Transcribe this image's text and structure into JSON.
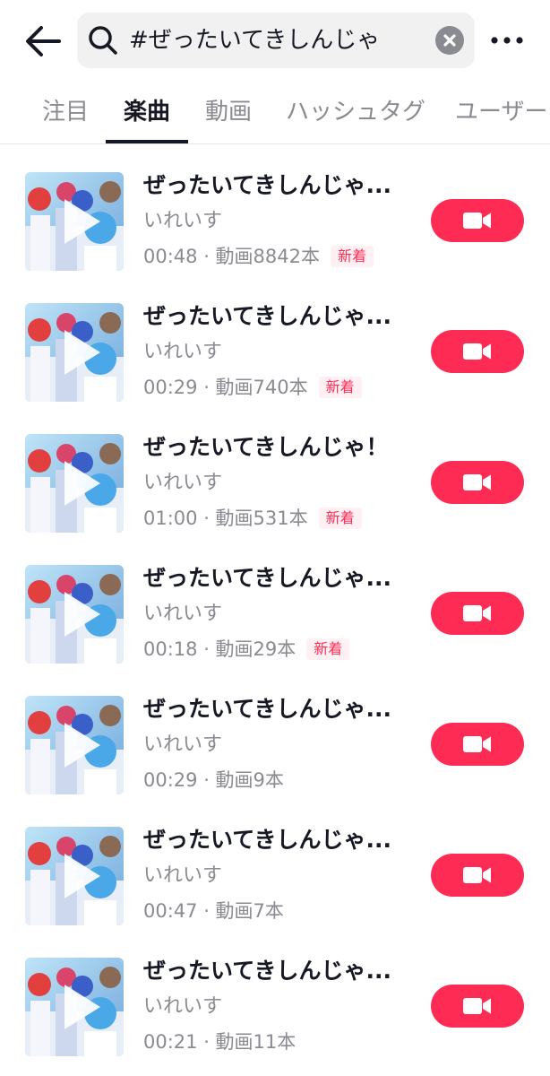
{
  "header": {
    "search_query": "#ぜったいてきしんじゃ"
  },
  "tabs": [
    {
      "label": "注目",
      "active": false
    },
    {
      "label": "楽曲",
      "active": true
    },
    {
      "label": "動画",
      "active": false
    },
    {
      "label": "ハッシュタグ",
      "active": false
    },
    {
      "label": "ユーザー",
      "active": false
    }
  ],
  "songs": [
    {
      "title": "ぜったいてきしんじゃ...",
      "artist": "いれいす",
      "meta": "00:48 · 動画8842本",
      "badge": "新着"
    },
    {
      "title": "ぜったいてきしんじゃ...",
      "artist": "いれいす",
      "meta": "00:29 · 動画740本",
      "badge": "新着"
    },
    {
      "title": "ぜったいてきしんじゃ！",
      "artist": "いれいす",
      "meta": "01:00 · 動画531本",
      "badge": "新着"
    },
    {
      "title": "ぜったいてきしんじゃ...",
      "artist": "いれいす",
      "meta": "00:18 · 動画29本",
      "badge": "新着"
    },
    {
      "title": "ぜったいてきしんじゃ...",
      "artist": "いれいす",
      "meta": "00:29 · 動画9本",
      "badge": ""
    },
    {
      "title": "ぜったいてきしんじゃ...",
      "artist": "いれいす",
      "meta": "00:47 · 動画7本",
      "badge": ""
    },
    {
      "title": "ぜったいてきしんじゃ...",
      "artist": "いれいす",
      "meta": "00:21 · 動画11本",
      "badge": ""
    }
  ],
  "colors": {
    "accent": "#fe2c55",
    "text_primary": "#161823",
    "text_secondary": "#8a8b91"
  },
  "icons": [
    "back-arrow-icon",
    "search-icon",
    "clear-icon",
    "more-icon",
    "play-icon",
    "video-camera-icon"
  ]
}
